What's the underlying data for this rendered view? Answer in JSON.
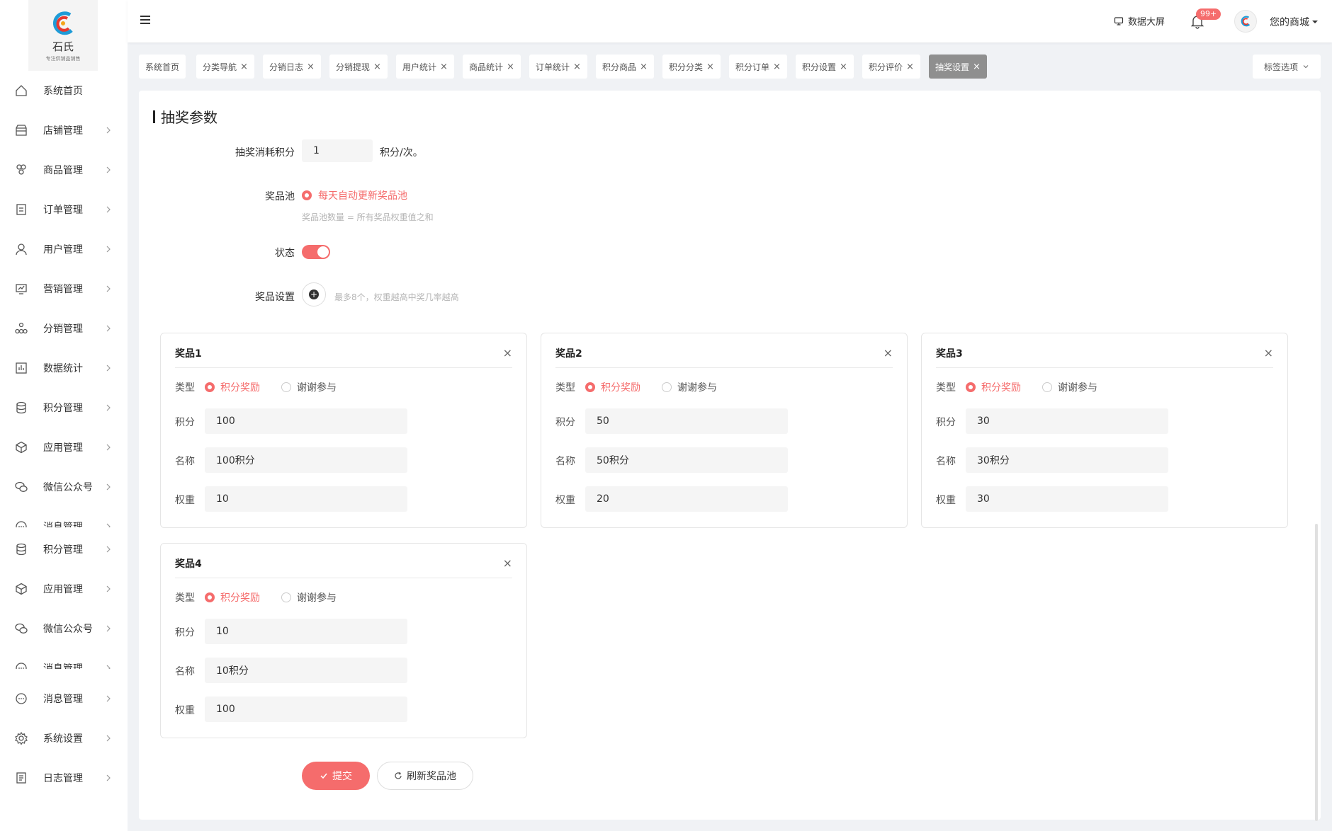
{
  "sidebar": {
    "logo_text": "石氏",
    "logo_sub": "专注供销品销售",
    "items": [
      {
        "label": "系统首页",
        "icon": "home-icon",
        "chevron": false
      },
      {
        "label": "店铺管理",
        "icon": "store-icon",
        "chevron": true
      },
      {
        "label": "商品管理",
        "icon": "goods-icon",
        "chevron": true
      },
      {
        "label": "订单管理",
        "icon": "order-icon",
        "chevron": true
      },
      {
        "label": "用户管理",
        "icon": "user-icon",
        "chevron": true
      },
      {
        "label": "营销管理",
        "icon": "marketing-icon",
        "chevron": true
      },
      {
        "label": "分销管理",
        "icon": "distribution-icon",
        "chevron": true
      },
      {
        "label": "数据统计",
        "icon": "chart-icon",
        "chevron": true
      },
      {
        "label": "积分管理",
        "icon": "database-icon",
        "chevron": true
      },
      {
        "label": "应用管理",
        "icon": "cube-icon",
        "chevron": true
      },
      {
        "label": "微信公众号",
        "icon": "wechat-icon",
        "chevron": true
      },
      {
        "label": "消息管理",
        "icon": "message-icon",
        "chevron": true
      },
      {
        "label": "积分管理",
        "icon": "database-icon",
        "chevron": true
      },
      {
        "label": "应用管理",
        "icon": "cube-icon",
        "chevron": true
      },
      {
        "label": "微信公众号",
        "icon": "wechat-icon",
        "chevron": true
      },
      {
        "label": "消息管理",
        "icon": "message-icon",
        "chevron": true
      },
      {
        "label": "消息管理",
        "icon": "message-icon",
        "chevron": true
      },
      {
        "label": "系统设置",
        "icon": "gear-icon",
        "chevron": true
      },
      {
        "label": "日志管理",
        "icon": "log-icon",
        "chevron": true
      }
    ]
  },
  "header": {
    "screen_label": "数据大屏",
    "badge": "99+",
    "shop_label": "您的商城"
  },
  "tags": [
    {
      "label": "系统首页",
      "closable": false,
      "active": false
    },
    {
      "label": "分类导航",
      "closable": true,
      "active": false
    },
    {
      "label": "分销日志",
      "closable": true,
      "active": false
    },
    {
      "label": "分销提现",
      "closable": true,
      "active": false
    },
    {
      "label": "用户统计",
      "closable": true,
      "active": false
    },
    {
      "label": "商品统计",
      "closable": true,
      "active": false
    },
    {
      "label": "订单统计",
      "closable": true,
      "active": false
    },
    {
      "label": "积分商品",
      "closable": true,
      "active": false
    },
    {
      "label": "积分分类",
      "closable": true,
      "active": false
    },
    {
      "label": "积分订单",
      "closable": true,
      "active": false
    },
    {
      "label": "积分设置",
      "closable": true,
      "active": false
    },
    {
      "label": "积分评价",
      "closable": true,
      "active": false
    },
    {
      "label": "抽奖设置",
      "closable": true,
      "active": true
    }
  ],
  "tag_options": "标签选项",
  "form": {
    "title": "抽奖参数",
    "cost_label": "抽奖消耗积分",
    "cost_value": "1",
    "cost_unit": "积分/次。",
    "pool_label": "奖品池",
    "pool_option": "每天自动更新奖品池",
    "pool_hint": "奖品池数量 = 所有奖品权重值之和",
    "status_label": "状态",
    "status_on": true,
    "prize_setting_label": "奖品设置",
    "prize_setting_hint": "最多8个，权重越高中奖几率越高"
  },
  "prize_field_labels": {
    "type": "类型",
    "points": "积分",
    "name": "名称",
    "weight": "权重",
    "type_option_a": "积分奖励",
    "type_option_b": "谢谢参与"
  },
  "prizes": [
    {
      "title": "奖品1",
      "points": "100",
      "name": "100积分",
      "weight": "10"
    },
    {
      "title": "奖品2",
      "points": "50",
      "name": "50积分",
      "weight": "20"
    },
    {
      "title": "奖品3",
      "points": "30",
      "name": "30积分",
      "weight": "30"
    },
    {
      "title": "奖品4",
      "points": "10",
      "name": "10积分",
      "weight": "100"
    }
  ],
  "buttons": {
    "submit": "提交",
    "refresh": "刷新奖品池"
  },
  "colors": {
    "accent": "#f56c6c",
    "active_tag": "#8f8f8f"
  }
}
